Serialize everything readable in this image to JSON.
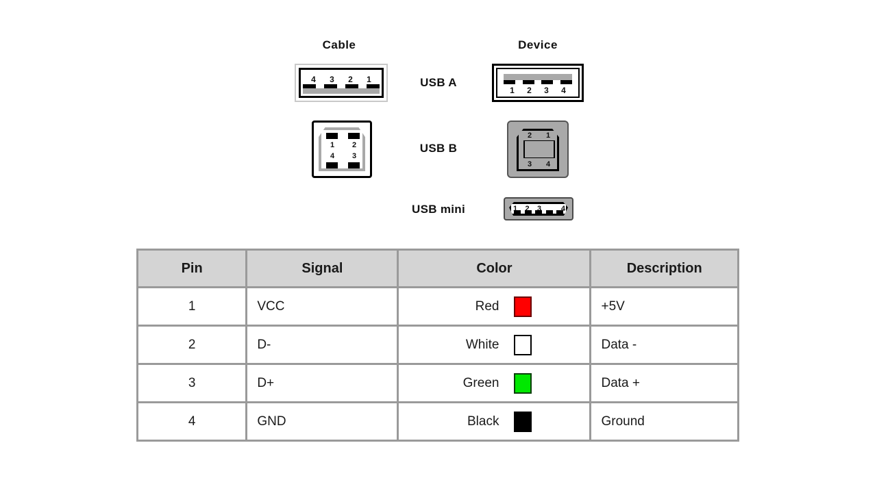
{
  "diagram": {
    "column_headers": {
      "cable": "Cable",
      "device": "Device"
    },
    "rows": [
      {
        "label": "USB A",
        "cable_pins": [
          "4",
          "3",
          "2",
          "1"
        ],
        "device_pins": [
          "1",
          "2",
          "3",
          "4"
        ]
      },
      {
        "label": "USB B",
        "cable_pins": [
          "1",
          "2",
          "4",
          "3"
        ],
        "device_pins": [
          "2",
          "1",
          "3",
          "4"
        ]
      },
      {
        "label": "USB mini",
        "cable_pins": [],
        "device_pins": [
          "1",
          "2",
          "3",
          "4"
        ]
      }
    ],
    "usba_cable_pins": {
      "p1": "4",
      "p2": "3",
      "p3": "2",
      "p4": "1"
    },
    "usba_device_pins": {
      "p1": "1",
      "p2": "2",
      "p3": "3",
      "p4": "4"
    },
    "usbb_cable_pins": {
      "tl": "1",
      "tr": "2",
      "bl": "4",
      "br": "3"
    },
    "usbb_device_pins": {
      "tl": "2",
      "tr": "1",
      "bl": "3",
      "br": "4"
    },
    "usbmini_pins": {
      "p1": "1",
      "p2": "2",
      "p3": "3",
      "p4": "4"
    }
  },
  "table": {
    "headers": {
      "pin": "Pin",
      "signal": "Signal",
      "color": "Color",
      "description": "Description"
    },
    "rows": [
      {
        "pin": "1",
        "signal": "VCC",
        "color_name": "Red",
        "color_hex": "#FF0000",
        "description": "+5V"
      },
      {
        "pin": "2",
        "signal": "D-",
        "color_name": "White",
        "color_hex": "#FFFFFF",
        "description": "Data -"
      },
      {
        "pin": "3",
        "signal": "D+",
        "color_name": "Green",
        "color_hex": "#00E800",
        "description": "Data +"
      },
      {
        "pin": "4",
        "signal": "GND",
        "color_name": "Black",
        "color_hex": "#000000",
        "description": "Ground"
      }
    ]
  }
}
